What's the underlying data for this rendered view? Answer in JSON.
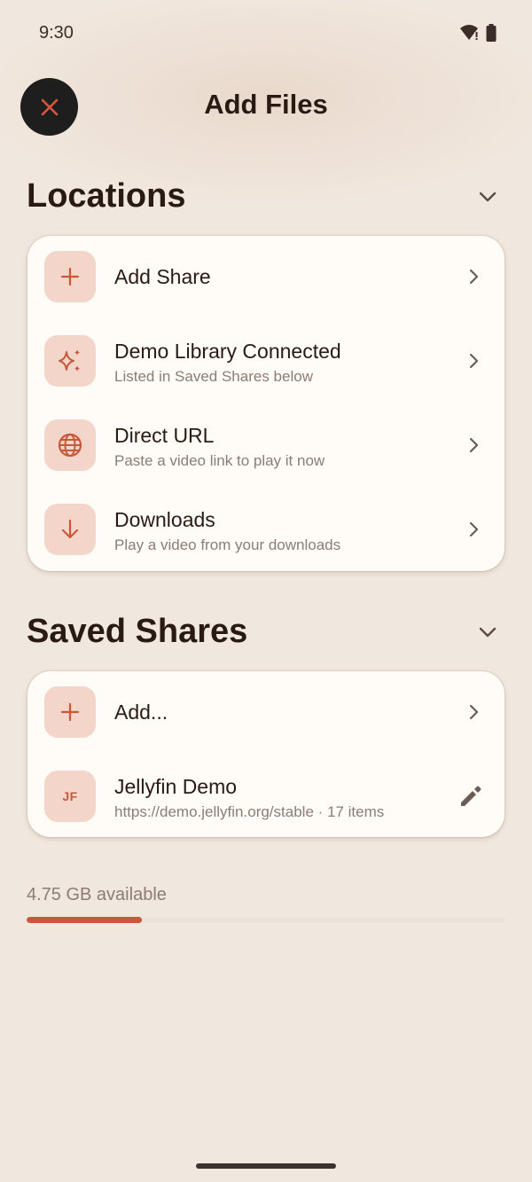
{
  "status_bar": {
    "time": "9:30",
    "icons": [
      "wifi-icon",
      "battery-icon"
    ]
  },
  "header": {
    "title": "Add Files",
    "close_icon": "close-icon"
  },
  "locations": {
    "title": "Locations",
    "items": [
      {
        "title": "Add Share",
        "subtitle": "",
        "icon": "plus-icon"
      },
      {
        "title": "Demo Library Connected",
        "subtitle": "Listed in Saved Shares below",
        "icon": "sparkle-icon"
      },
      {
        "title": "Direct URL",
        "subtitle": "Paste a video link to play it now",
        "icon": "globe-icon"
      },
      {
        "title": "Downloads",
        "subtitle": "Play a video from your downloads",
        "icon": "download-icon"
      }
    ]
  },
  "saved_shares": {
    "title": "Saved Shares",
    "items": [
      {
        "title": "Add...",
        "subtitle": "",
        "icon": "plus-icon"
      },
      {
        "title": "Jellyfin Demo",
        "subtitle": "https://demo.jellyfin.org/stable · 17 items",
        "badge": "JF",
        "action_icon": "edit-icon"
      }
    ]
  },
  "storage": {
    "label": "4.75 GB available",
    "used_fraction": 0.24
  },
  "colors": {
    "background": "#f0e7de",
    "card": "#fffbf6",
    "accent": "#c8583a",
    "icon_tile": "#f3d6c9",
    "close_button": "#1f1e1f"
  }
}
